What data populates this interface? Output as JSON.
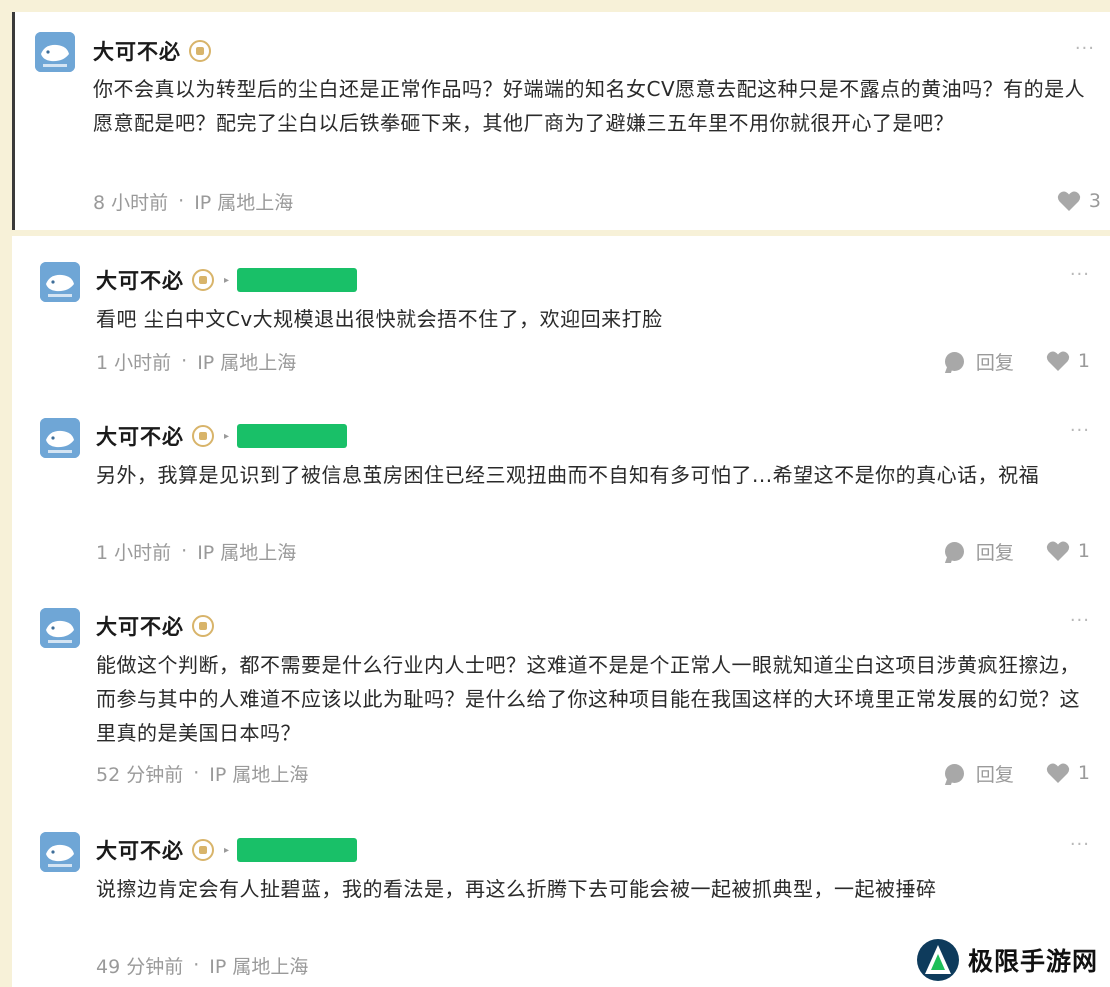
{
  "top_comment": {
    "username": "大可不必",
    "content": "你不会真以为转型后的尘白还是正常作品吗？好端端的知名女CV愿意去配这种只是不露点的黄油吗？有的是人愿意配是吧？配完了尘白以后铁拳砸下来，其他厂商为了避嫌三五年里不用你就很开心了是吧？",
    "time": "8 小时前",
    "separator": "·",
    "location": "IP 属地上海",
    "likes": "3",
    "more": "···"
  },
  "replies": [
    {
      "username": "大可不必",
      "content": "看吧 尘白中文Cv大规模退出很快就会捂不住了，欢迎回来打脸",
      "time": "1 小时前",
      "separator": "·",
      "location": "IP 属地上海",
      "reply_label": "回复",
      "likes": "1",
      "more": "···"
    },
    {
      "username": "大可不必",
      "content": "另外，我算是见识到了被信息茧房困住已经三观扭曲而不自知有多可怕了...希望这不是你的真心话，祝福",
      "time": "1 小时前",
      "separator": "·",
      "location": "IP 属地上海",
      "reply_label": "回复",
      "likes": "1",
      "more": "···"
    },
    {
      "username": "大可不必",
      "content": "能做这个判断，都不需要是什么行业内人士吧？这难道不是是个正常人一眼就知道尘白这项目涉黄疯狂擦边，而参与其中的人难道不应该以此为耻吗？是什么给了你这种项目能在我国这样的大环境里正常发展的幻觉？这里真的是美国日本吗？",
      "time": "52 分钟前",
      "separator": "·",
      "location": "IP 属地上海",
      "reply_label": "回复",
      "likes": "1",
      "more": "···"
    },
    {
      "username": "大可不必",
      "content": "说擦边肯定会有人扯碧蓝，我的看法是，再这么折腾下去可能会被一起被抓典型，一起被捶碎",
      "time": "49 分钟前",
      "separator": "·",
      "location": "IP 属地上海",
      "more": "···"
    }
  ],
  "watermark": {
    "text": "极限手游网"
  },
  "colors": {
    "background": "#f7f1d8",
    "redaction": "#19c068",
    "badge": "#d8b46a",
    "muted_text": "#9a9a9a"
  },
  "icons": {
    "avatar": "whale-avatar",
    "level": "level-badge-icon",
    "reply": "speech-bubble-icon",
    "like": "heart-icon",
    "more": "more-dots-icon"
  }
}
